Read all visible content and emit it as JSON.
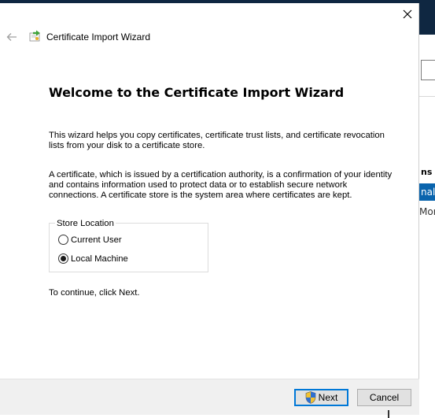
{
  "window": {
    "title": "Certificate Import Wizard"
  },
  "background_window": {
    "column_header": "ns",
    "selected_row": "nal",
    "more_text": "More"
  },
  "content": {
    "heading": "Welcome to the Certificate Import Wizard",
    "para1": "This wizard helps you copy certificates, certificate trust lists, and certificate revocation lists from your disk to a certificate store.",
    "para2": "A certificate, which is issued by a certification authority, is a confirmation of your identity and contains information used to protect data or to establish secure network connections. A certificate store is the system area where certificates are kept.",
    "store_location": {
      "legend": "Store Location",
      "options": [
        {
          "label": "Current User",
          "selected": false
        },
        {
          "label": "Local Machine",
          "selected": true
        }
      ]
    },
    "continue_text": "To continue, click Next."
  },
  "footer": {
    "next_label": "Next",
    "cancel_label": "Cancel"
  },
  "colors": {
    "titlebar_dark": "#0f2741",
    "accent": "#0078d7",
    "footer_bg": "#f0f0f0"
  }
}
